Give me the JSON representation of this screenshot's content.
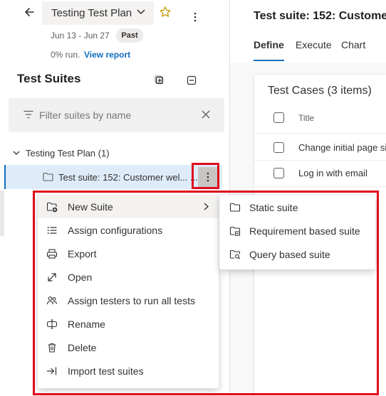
{
  "header": {
    "plan_name": "Testing Test Plan",
    "dates": "Jun 13 - Jun 27",
    "badge": "Past",
    "run_status": "0% run.",
    "view_report": "View report"
  },
  "sidebar": {
    "title": "Test Suites",
    "filter_placeholder": "Filter suites by name",
    "tree_root": "Testing Test Plan (1)",
    "selected_suite": "Test suite: 152: Customer wel... ..."
  },
  "main": {
    "suite_title": "Test suite: 152: Customer",
    "tabs": [
      "Define",
      "Execute",
      "Chart"
    ],
    "active_tab": "Define",
    "cases_title": "Test Cases (3 items)",
    "column_header": "Title",
    "cases": [
      "Change initial page si",
      "Log in with email",
      ""
    ]
  },
  "context_menu": {
    "items": [
      {
        "label": "New Suite",
        "icon": "new-suite-icon",
        "has_submenu": true
      },
      {
        "label": "Assign configurations",
        "icon": "assign-configurations-icon"
      },
      {
        "label": "Export",
        "icon": "printer-icon"
      },
      {
        "label": "Open",
        "icon": "open-expand-icon"
      },
      {
        "label": "Assign testers to run all tests",
        "icon": "people-icon"
      },
      {
        "label": "Rename",
        "icon": "rename-icon"
      },
      {
        "label": "Delete",
        "icon": "trash-icon"
      },
      {
        "label": "Import test suites",
        "icon": "import-icon"
      }
    ],
    "submenu": [
      {
        "label": "Static suite",
        "icon": "folder-icon"
      },
      {
        "label": "Requirement based suite",
        "icon": "requirement-folder-icon"
      },
      {
        "label": "Query based suite",
        "icon": "query-folder-icon"
      }
    ]
  },
  "colors": {
    "accent": "#0f6cbd",
    "highlight_border": "#e00b1c",
    "selected_row": "#deecf9"
  }
}
